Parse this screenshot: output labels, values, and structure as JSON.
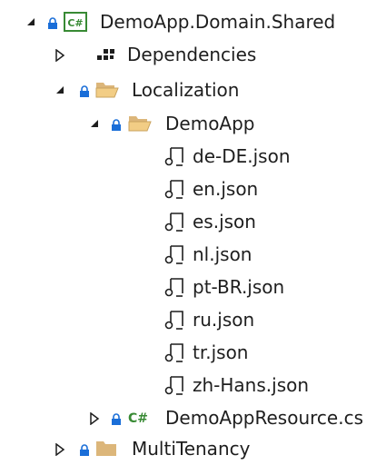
{
  "tree": {
    "project": {
      "label": "DemoApp.Domain.Shared",
      "icon": "csharp-project-icon",
      "expanded": true
    },
    "dependencies": {
      "label": "Dependencies",
      "icon": "dependencies-icon",
      "expanded": false
    },
    "localization": {
      "label": "Localization",
      "icon": "folder-open-icon",
      "expanded": true
    },
    "demoapp_folder": {
      "label": "DemoApp",
      "icon": "folder-open-icon",
      "expanded": true
    },
    "json_files": [
      {
        "label": "de-DE.json",
        "icon": "json-file-icon"
      },
      {
        "label": "en.json",
        "icon": "json-file-icon"
      },
      {
        "label": "es.json",
        "icon": "json-file-icon"
      },
      {
        "label": "nl.json",
        "icon": "json-file-icon"
      },
      {
        "label": "pt-BR.json",
        "icon": "json-file-icon"
      },
      {
        "label": "ru.json",
        "icon": "json-file-icon"
      },
      {
        "label": "tr.json",
        "icon": "json-file-icon"
      },
      {
        "label": "zh-Hans.json",
        "icon": "json-file-icon"
      }
    ],
    "resource_file": {
      "label": "DemoAppResource.cs",
      "icon": "csharp-file-icon",
      "expanded": false
    },
    "multitenancy": {
      "label": "MultiTenancy",
      "icon": "folder-closed-icon",
      "expanded": false
    }
  },
  "colors": {
    "lock_blue": "#1a6ed8",
    "folder_tan": "#dcb67a",
    "csharp_green": "#388a34",
    "text": "#1e1e1e"
  }
}
